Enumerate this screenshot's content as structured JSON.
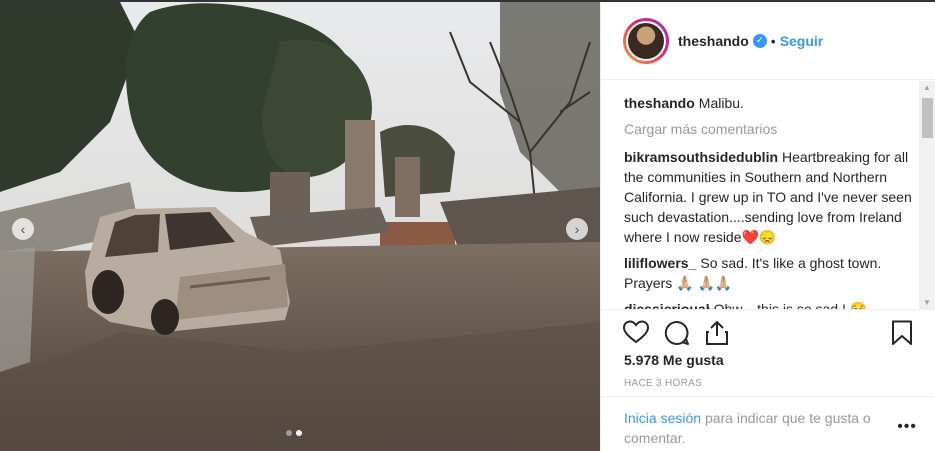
{
  "post": {
    "username": "theshando",
    "follow_label": "Seguir",
    "bullet": "•",
    "verified_icon": "verified-badge-icon"
  },
  "caption": {
    "username": "theshando",
    "text": "Malibu."
  },
  "load_more_label": "Cargar más comentarios",
  "comments": [
    {
      "username": "bikramsouthsidedublin",
      "text": "Heartbreaking for all the communities in Southern and Northern California. I grew up in TO and I've never seen such devastation....sending love from Ireland where I now reside❤️😞"
    },
    {
      "username": "liliflowers_",
      "text": "So sad. It's like a ghost town. Prayers 🙏🏼 🙏🏼🙏🏼"
    },
    {
      "username": "djessieriouał",
      "text": "Ohw... this is so sad ! 😥"
    }
  ],
  "likes_label": "5.978 Me gusta",
  "time_label": "HACE 3 HORAS",
  "login": {
    "link": "Inicia sesión",
    "rest": "para indicar que te gusta o comentar."
  },
  "more_label": "•••",
  "carousel": {
    "prev": "‹",
    "next": "›",
    "total": 2,
    "active": 2
  },
  "colors": {
    "accent": "#3897f0",
    "text": "#262626",
    "muted": "#999999"
  }
}
